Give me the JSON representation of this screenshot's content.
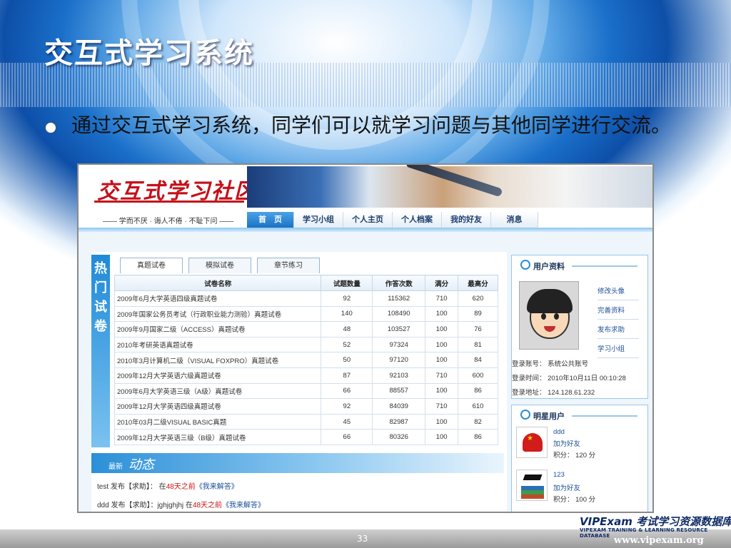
{
  "slide": {
    "title": "交互式学习系统",
    "bullet": "通过交互式学习系统，同学们可以就学习问题与其他同学进行交流。",
    "page_number": "33"
  },
  "site": {
    "logo_text": "交互式学习社区",
    "slogan": "—— 学而不厌 · 诲人不倦 · 不耻下问 ——",
    "nav": [
      "首　页",
      "学习小组",
      "个人主页",
      "个人档案",
      "我的好友",
      "消息"
    ],
    "active_nav": 0
  },
  "hot_exams": {
    "side_label": [
      "热",
      "门",
      "试",
      "卷"
    ],
    "tabs": [
      "真题试卷",
      "模拟试卷",
      "章节练习"
    ],
    "columns": [
      "试卷名称",
      "试题数量",
      "作答次数",
      "满分",
      "最高分"
    ],
    "rows": [
      [
        "2009年6月大学英语四级真题试卷",
        "92",
        "115362",
        "710",
        "620"
      ],
      [
        "2009年国家公务员考试（行政职业能力测验）真题试卷",
        "140",
        "108490",
        "100",
        "89"
      ],
      [
        "2009年9月国家二级（ACCESS）真题试卷",
        "48",
        "103527",
        "100",
        "76"
      ],
      [
        "2010年考研英语真题试卷",
        "52",
        "97324",
        "100",
        "81"
      ],
      [
        "2010年3月计算机二级（VISUAL FOXPRO）真题试卷",
        "50",
        "97120",
        "100",
        "84"
      ],
      [
        "2009年12月大学英语六级真题试卷",
        "87",
        "92103",
        "710",
        "600"
      ],
      [
        "2009年6月大学英语三级（A级）真题试卷",
        "66",
        "88557",
        "100",
        "86"
      ],
      [
        "2009年12月大学英语四级真题试卷",
        "92",
        "84039",
        "710",
        "610"
      ],
      [
        "2010年03月二级VISUAL BASIC真题",
        "45",
        "82987",
        "100",
        "82"
      ],
      [
        "2009年12月大学英语三级（B级）真题试卷",
        "66",
        "80326",
        "100",
        "86"
      ]
    ]
  },
  "dynamics": {
    "small_label": "最新",
    "big_label": "动态",
    "items": [
      {
        "prefix": "test 发布【求助】： 在",
        "time": "48天之前",
        "link": "《我来解答》"
      },
      {
        "prefix": "ddd 发布【求助】：jghjghjhj 在",
        "time": "48天之前",
        "link": "《我来解答》"
      }
    ]
  },
  "user_profile": {
    "title": "用户资料",
    "links": [
      "修改头像",
      "完善资料",
      "发布求助",
      "学习小组"
    ],
    "account": "登录账号： 系统公共账号",
    "login_time": "登录时间： 2010年10月11日 00:10:28",
    "login_ip": "登录地址： 124.128.61.232"
  },
  "star_users": {
    "title": "明星用户",
    "users": [
      {
        "name": "ddd",
        "action": "加为好友",
        "score": "积分： 120 分"
      },
      {
        "name": "123",
        "action": "加为好友",
        "score": "积分： 100 分"
      }
    ]
  },
  "brand": {
    "logo": "VIPExam 考试学习资源数据库",
    "sub": "VIPEXAM TRAINING & LEARNING RESOURCE DATABASE",
    "url": "www.vipexam.org"
  }
}
